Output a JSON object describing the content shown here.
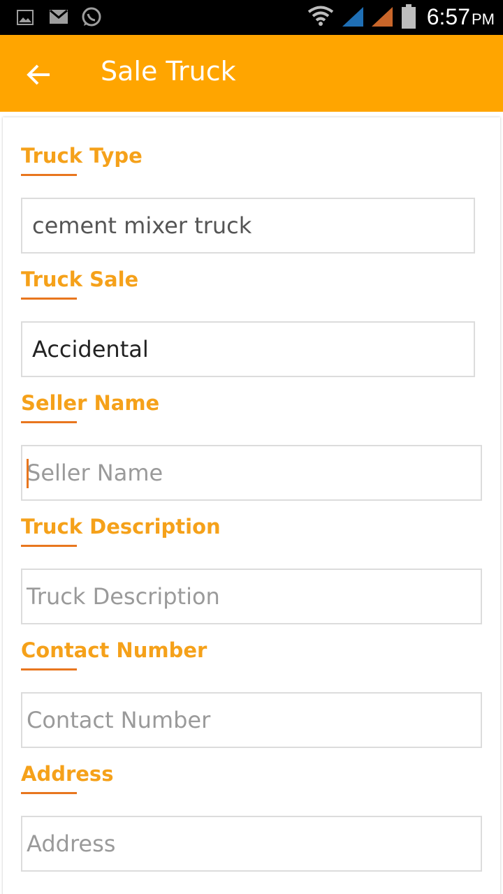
{
  "status_bar": {
    "time": "6:57",
    "ampm": "PM",
    "left_icons": [
      "gallery-icon",
      "gmail-icon",
      "whatsapp-icon"
    ],
    "right_icons": [
      "wifi-icon",
      "signal-icon",
      "signal-icon",
      "battery-icon"
    ]
  },
  "app_bar": {
    "title": "Sale Truck",
    "back_icon": "arrow-left-icon",
    "color": "#FFA500"
  },
  "form": {
    "label_color": "#F5A11A",
    "fields": [
      {
        "label": "Truck Type",
        "value": "cement mixer truck",
        "placeholder": ""
      },
      {
        "label": "Truck Sale",
        "value": "Accidental",
        "placeholder": ""
      },
      {
        "label": "Seller Name",
        "value": "",
        "placeholder": "Seller Name"
      },
      {
        "label": "Truck Description",
        "value": "",
        "placeholder": "Truck Description"
      },
      {
        "label": "Contact Number",
        "value": "",
        "placeholder": "Contact Number"
      },
      {
        "label": "Address",
        "value": "",
        "placeholder": "Address"
      }
    ]
  }
}
